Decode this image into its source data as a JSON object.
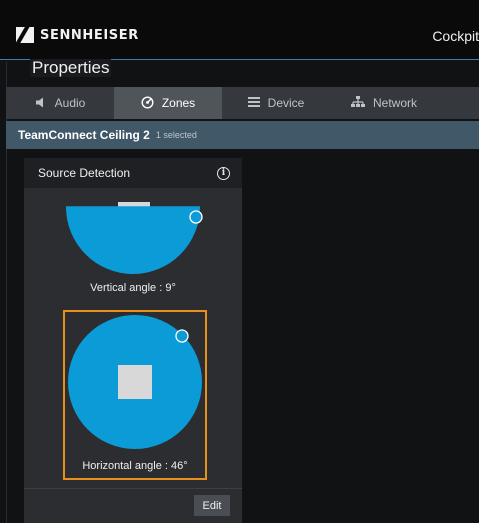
{
  "header": {
    "brand": "SENNHEISER",
    "app_title": "Cockpit"
  },
  "properties": {
    "title": "Properties"
  },
  "tabs": [
    {
      "label": "Audio",
      "icon": "speaker-icon",
      "active": false
    },
    {
      "label": "Zones",
      "icon": "zones-icon",
      "active": true
    },
    {
      "label": "Device",
      "icon": "device-icon",
      "active": false
    },
    {
      "label": "Network",
      "icon": "network-icon",
      "active": false
    }
  ],
  "device": {
    "name": "TeamConnect Ceiling 2",
    "selection": "1 selected"
  },
  "source_detection": {
    "title": "Source Detection",
    "info_icon": "info-icon",
    "vertical_label": "Vertical angle : 9°",
    "horizontal_label": "Horizontal angle : 46°",
    "edit_label": "Edit"
  },
  "colors": {
    "accent_blue": "#0b9bd6",
    "selection_orange": "#e8901c",
    "device_bar": "#405868"
  }
}
